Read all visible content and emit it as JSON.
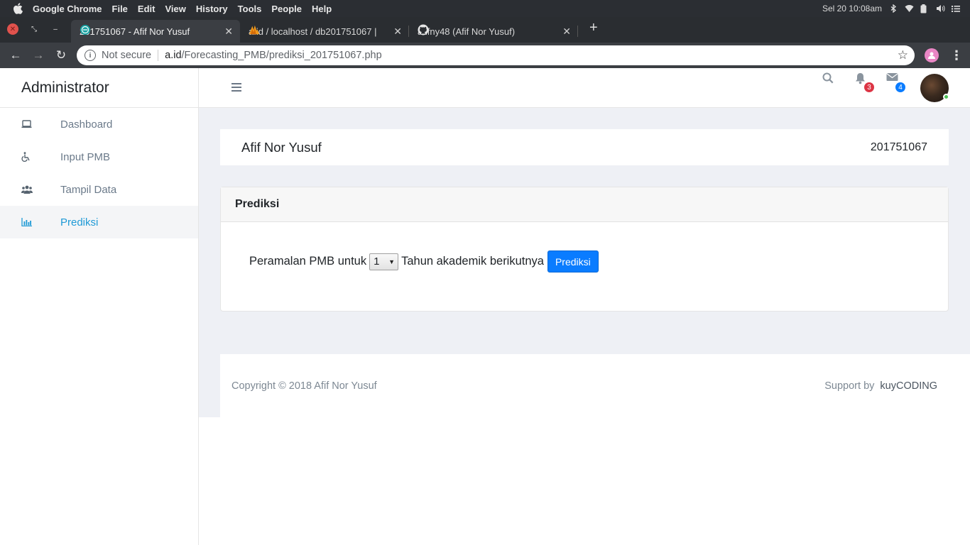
{
  "os": {
    "app_name": "Google Chrome",
    "menu": [
      "File",
      "Edit",
      "View",
      "History",
      "Tools",
      "People",
      "Help"
    ],
    "clock": "Sel 20 10:08am"
  },
  "browser": {
    "tabs": [
      {
        "title": "201751067 - Afif Nor Yusuf",
        "active": true,
        "icon": "site-favicon"
      },
      {
        "title": "a.id / localhost / db201751067 |",
        "active": false,
        "icon": "phpmyadmin-favicon"
      },
      {
        "title": "afifny48 (Afif Nor Yusuf)",
        "active": false,
        "icon": "github-favicon"
      }
    ],
    "url": {
      "security": "Not secure",
      "host": "a.id",
      "path": "/Forecasting_PMB/prediksi_201751067.php"
    }
  },
  "app": {
    "brand": "Administrator",
    "sidebar": [
      {
        "label": "Dashboard",
        "icon": "laptop-icon",
        "active": false
      },
      {
        "label": "Input PMB",
        "icon": "wheelchair-icon",
        "active": false
      },
      {
        "label": "Tampil Data",
        "icon": "users-icon",
        "active": false
      },
      {
        "label": "Prediksi",
        "icon": "bar-chart-icon",
        "active": true
      }
    ],
    "topbar": {
      "notifications_count": "3",
      "messages_count": "4"
    },
    "profile": {
      "name": "Afif Nor Yusuf",
      "id": "201751067"
    },
    "card": {
      "title": "Prediksi",
      "text_before": "Peramalan PMB untuk",
      "select_value": "1",
      "text_after": "Tahun akademik berikutnya",
      "button_label": "Prediksi"
    },
    "footer": {
      "copyright": "Copyright © 2018 Afif Nor Yusuf",
      "support_prefix": "Support by",
      "support_name": "kuyCODING"
    },
    "colors": {
      "accent": "#1f9ad6",
      "primary_button": "#0a7cff",
      "badge_red": "#dc3545",
      "badge_blue": "#0a7cff"
    }
  }
}
